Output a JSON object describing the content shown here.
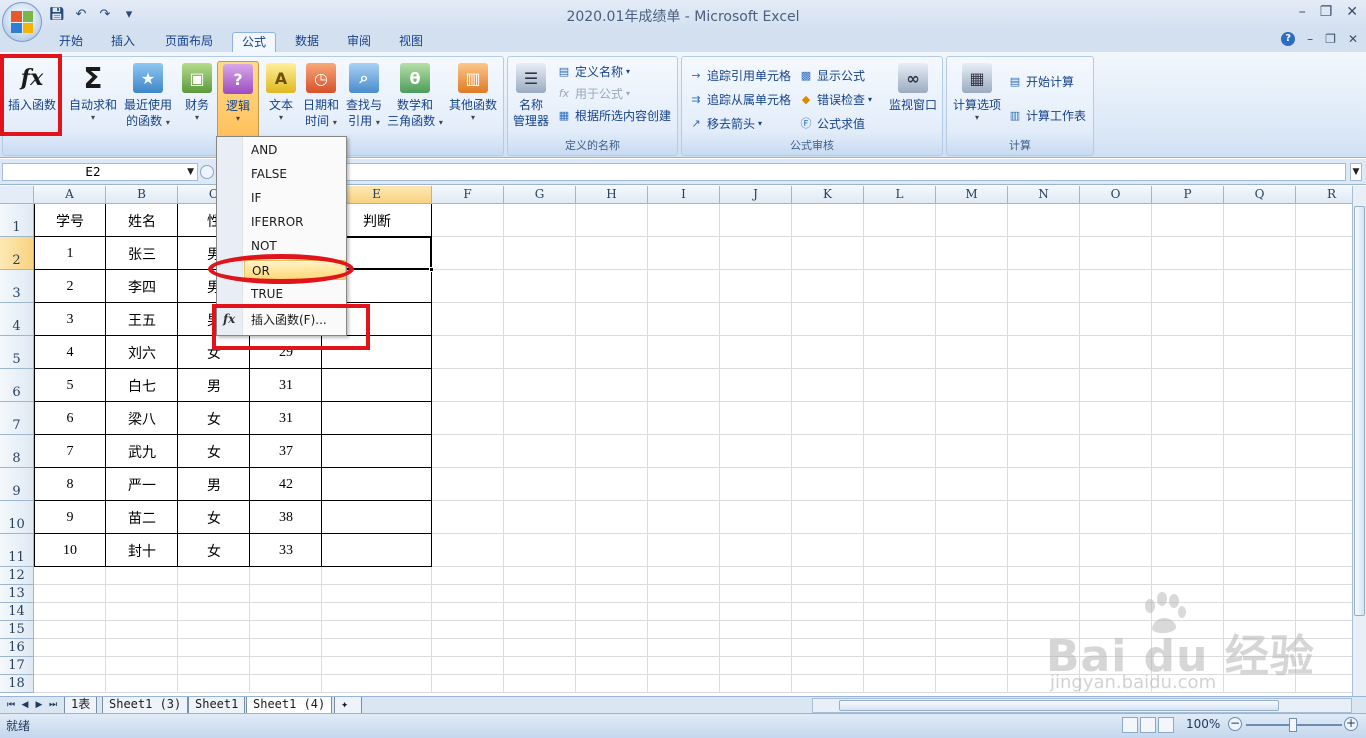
{
  "window": {
    "title": "2020.01年成绩单 - Microsoft Excel"
  },
  "tabs": [
    {
      "label": "开始"
    },
    {
      "label": "插入"
    },
    {
      "label": "页面布局"
    },
    {
      "label": "公式",
      "active": true
    },
    {
      "label": "数据"
    },
    {
      "label": "审阅"
    },
    {
      "label": "视图"
    }
  ],
  "ribbon": {
    "function_library": {
      "insert_function": "插入函数",
      "autosum_label": "自动求和",
      "recent_line1": "最近使用",
      "recent_line2": "的函数",
      "financial": "财务",
      "logical": "逻辑",
      "text": "文本",
      "datetime_line1": "日期和",
      "datetime_line2": "时间",
      "lookup_line1": "查找与",
      "lookup_line2": "引用",
      "math_line1": "数学和",
      "math_line2": "三角函数",
      "more": "其他函数"
    },
    "defined_names": {
      "name_manager_line1": "名称",
      "name_manager_line2": "管理器",
      "define_name": "定义名称",
      "use_in_formula": "用于公式",
      "create_from_selection": "根据所选内容创建",
      "group_label": "定义的名称"
    },
    "formula_auditing": {
      "trace_precedents": "追踪引用单元格",
      "trace_dependents": "追踪从属单元格",
      "remove_arrows": "移去箭头",
      "show_formulas": "显示公式",
      "error_checking": "错误检查",
      "evaluate_formula": "公式求值",
      "watch_window": "监视窗口",
      "group_label": "公式审核"
    },
    "calculation": {
      "options": "计算选项",
      "calc_now": "开始计算",
      "calc_sheet": "计算工作表",
      "group_label": "计算"
    }
  },
  "formula_bar": {
    "name_box": "E2",
    "formula": ""
  },
  "grid": {
    "columns": [
      "A",
      "B",
      "C",
      "D",
      "E",
      "F",
      "G",
      "H",
      "I",
      "J",
      "K",
      "L",
      "M",
      "N",
      "O",
      "P",
      "Q",
      "R"
    ],
    "rows": [
      "1",
      "2",
      "3",
      "4",
      "5",
      "6",
      "7",
      "8",
      "9",
      "10",
      "11",
      "12",
      "13",
      "14",
      "15",
      "16",
      "17",
      "18"
    ],
    "selected_cell": "E2",
    "visible_cells": [
      {
        "ref": "A1",
        "value": "学号"
      },
      {
        "ref": "B1",
        "value": "姓名"
      },
      {
        "ref": "C1",
        "value": "性"
      },
      {
        "ref": "E1",
        "value": "判断"
      },
      {
        "ref": "A2",
        "value": "1"
      },
      {
        "ref": "B2",
        "value": "张三"
      },
      {
        "ref": "C2",
        "value": "男"
      },
      {
        "ref": "A3",
        "value": "2"
      },
      {
        "ref": "B3",
        "value": "李四"
      },
      {
        "ref": "C3",
        "value": "男"
      },
      {
        "ref": "A4",
        "value": "3"
      },
      {
        "ref": "B4",
        "value": "王五"
      },
      {
        "ref": "C4",
        "value": "男"
      },
      {
        "ref": "A5",
        "value": "4"
      },
      {
        "ref": "B5",
        "value": "刘六"
      },
      {
        "ref": "C5",
        "value": "女"
      },
      {
        "ref": "D5",
        "value": "29"
      },
      {
        "ref": "A6",
        "value": "5"
      },
      {
        "ref": "B6",
        "value": "白七"
      },
      {
        "ref": "C6",
        "value": "男"
      },
      {
        "ref": "D6",
        "value": "31"
      },
      {
        "ref": "A7",
        "value": "6"
      },
      {
        "ref": "B7",
        "value": "梁八"
      },
      {
        "ref": "C7",
        "value": "女"
      },
      {
        "ref": "D7",
        "value": "31"
      },
      {
        "ref": "A8",
        "value": "7"
      },
      {
        "ref": "B8",
        "value": "武九"
      },
      {
        "ref": "C8",
        "value": "女"
      },
      {
        "ref": "D8",
        "value": "37"
      },
      {
        "ref": "A9",
        "value": "8"
      },
      {
        "ref": "B9",
        "value": "严一"
      },
      {
        "ref": "C9",
        "value": "男"
      },
      {
        "ref": "D9",
        "value": "42"
      },
      {
        "ref": "A10",
        "value": "9"
      },
      {
        "ref": "B10",
        "value": "苗二"
      },
      {
        "ref": "C10",
        "value": "女"
      },
      {
        "ref": "D10",
        "value": "38"
      },
      {
        "ref": "A11",
        "value": "10"
      },
      {
        "ref": "B11",
        "value": "封十"
      },
      {
        "ref": "C11",
        "value": "女"
      },
      {
        "ref": "D11",
        "value": "33"
      }
    ]
  },
  "logical_menu": {
    "items": [
      "AND",
      "FALSE",
      "IF",
      "IFERROR",
      "NOT",
      "OR",
      "TRUE"
    ],
    "highlighted": "OR",
    "insert_function": "插入函数(F)..."
  },
  "sheets": [
    {
      "label": "1表"
    },
    {
      "label": "Sheet1 (3)"
    },
    {
      "label": "Sheet1"
    },
    {
      "label": "Sheet1 (4)",
      "active": true
    }
  ],
  "status": {
    "text": "就绪",
    "zoom": "100%"
  },
  "watermark": {
    "brand": "Bai du 经验",
    "url": "jingyan.baidu.com"
  },
  "colors": {
    "annotation": "#e0141a",
    "ribbon_bg": "#dde9f7",
    "active_tab_border": "#8db2e3",
    "selection_header": "#f9d281"
  }
}
